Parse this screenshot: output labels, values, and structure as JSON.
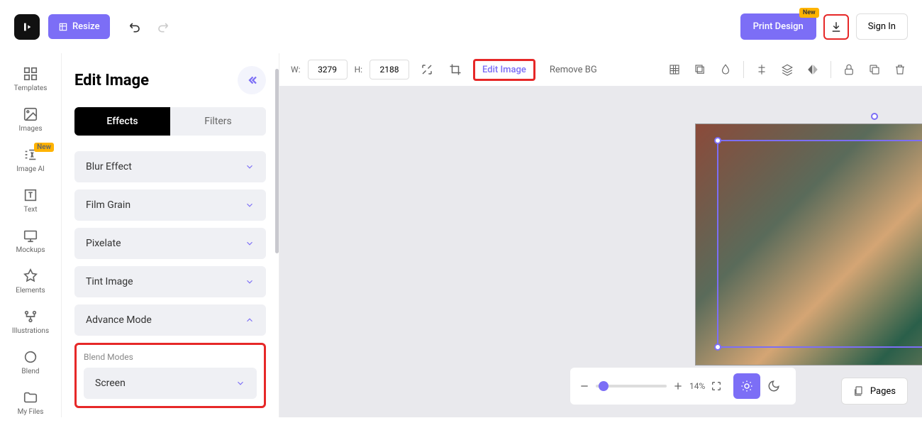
{
  "topbar": {
    "resize": "Resize",
    "print": "Print Design",
    "new_badge": "New",
    "signin": "Sign In"
  },
  "iconbar": {
    "templates": "Templates",
    "images": "Images",
    "imageai": "Image AI",
    "imageai_badge": "New",
    "text": "Text",
    "mockups": "Mockups",
    "elements": "Elements",
    "illustrations": "Illustrations",
    "blend": "Blend",
    "myfiles": "My Files"
  },
  "panel": {
    "title": "Edit Image",
    "tab_effects": "Effects",
    "tab_filters": "Filters"
  },
  "accordions": {
    "blur": "Blur Effect",
    "grain": "Film Grain",
    "pixelate": "Pixelate",
    "tint": "Tint Image",
    "advance": "Advance Mode"
  },
  "blend": {
    "label": "Blend Modes",
    "selected": "Screen"
  },
  "canvas": {
    "w_label": "W:",
    "w_value": "3279",
    "h_label": "H:",
    "h_value": "2188",
    "edit_image": "Edit Image",
    "remove_bg": "Remove BG",
    "zoom": "14%",
    "pages": "Pages"
  }
}
